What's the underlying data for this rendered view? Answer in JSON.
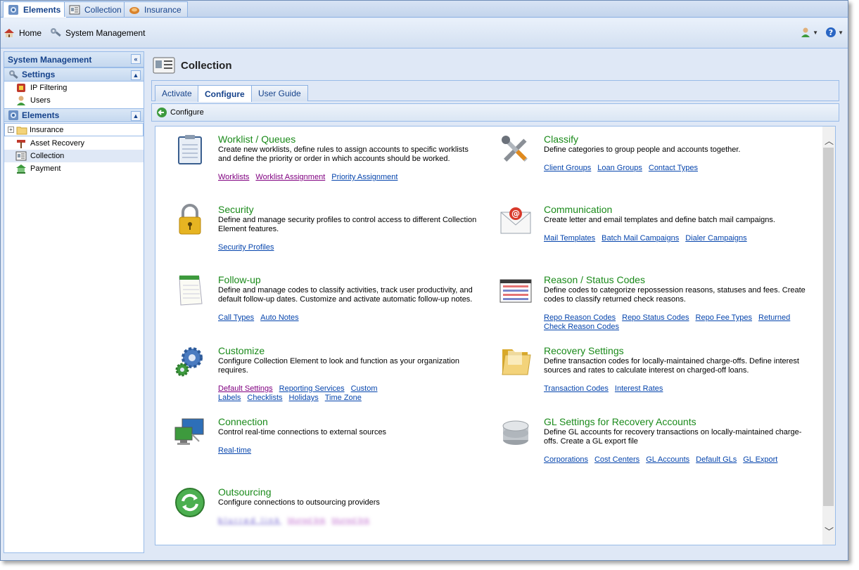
{
  "app_tabs": [
    {
      "label": "Elements",
      "icon": "elements-icon",
      "active": true
    },
    {
      "label": "Collection",
      "icon": "collection-icon",
      "active": false
    },
    {
      "label": "Insurance",
      "icon": "insurance-icon",
      "active": false
    }
  ],
  "toolbar": {
    "home_label": "Home",
    "sysmgmt_label": "System Management"
  },
  "left_panel": {
    "title": "System Management",
    "settings_title": "Settings",
    "settings_items": [
      "IP Filtering",
      "Users"
    ],
    "elements_title": "Elements",
    "tree_item": "Insurance",
    "element_items": [
      "Asset Recovery",
      "Collection",
      "Payment"
    ]
  },
  "main": {
    "title": "Collection",
    "tabs": [
      "Activate",
      "Configure",
      "User Guide"
    ],
    "subbar_label": "Configure"
  },
  "cards": [
    {
      "title": "Worklist / Queues",
      "desc": "Create new worklists, define rules to assign accounts to specific worklists and define the priority or order in which accounts should be worked.",
      "links": [
        "Worklists",
        "Worklist Assignment",
        "Priority Assignment"
      ]
    },
    {
      "title": "Classify",
      "desc": "Define categories to group people and accounts together.",
      "links": [
        "Client Groups",
        "Loan Groups",
        "Contact Types"
      ]
    },
    {
      "title": "Security",
      "desc": "Define and manage security profiles to control access to different Collection Element features.",
      "links": [
        "Security Profiles"
      ]
    },
    {
      "title": "Communication",
      "desc": "Create letter and email templates and define batch mail campaigns.",
      "links": [
        "Mail Templates",
        "Batch Mail Campaigns",
        "Dialer Campaigns"
      ]
    },
    {
      "title": "Follow-up",
      "desc": "Define and manage codes to classify activities, track user productivity, and default follow-up dates. Customize and activate automatic follow-up notes.",
      "links": [
        "Call Types",
        "Auto Notes"
      ]
    },
    {
      "title": "Reason / Status Codes",
      "desc": "Define codes to categorize repossession reasons, statuses and fees. Create codes to classify returned check reasons.",
      "links": [
        "Repo Reason Codes",
        "Repo Status Codes",
        "Repo Fee Types",
        "Returned Check Reason Codes"
      ]
    },
    {
      "title": "Customize",
      "desc": "Configure Collection Element to look and function as your organization requires.",
      "links": [
        "Default Settings",
        "Reporting Services",
        "Custom Labels",
        "Checklists",
        "Holidays",
        "Time Zone"
      ]
    },
    {
      "title": "Recovery Settings",
      "desc": "Define transaction codes for locally-maintained charge-offs. Define interest sources and rates to calculate interest on charged-off loans.",
      "links": [
        "Transaction Codes",
        "Interest Rates"
      ]
    },
    {
      "title": "Connection",
      "desc": "Control real-time connections to external sources",
      "links": [
        "Real-time"
      ]
    },
    {
      "title": "GL Settings for Recovery Accounts",
      "desc": "Define GL accounts for recovery transactions on locally-maintained charge-offs. Create a GL export file",
      "links": [
        "Corporations",
        "Cost Centers",
        "GL Accounts",
        "Default GLs",
        "GL Export"
      ]
    },
    {
      "title": "Outsourcing",
      "desc": "Configure connections to outsourcing providers",
      "links": [
        "blurred link",
        "blurred link",
        "blurred link"
      ]
    }
  ],
  "colors": {
    "accent": "#15428b",
    "title_green": "#1a8a1a",
    "link": "#0645ad",
    "visited": "#800080"
  }
}
